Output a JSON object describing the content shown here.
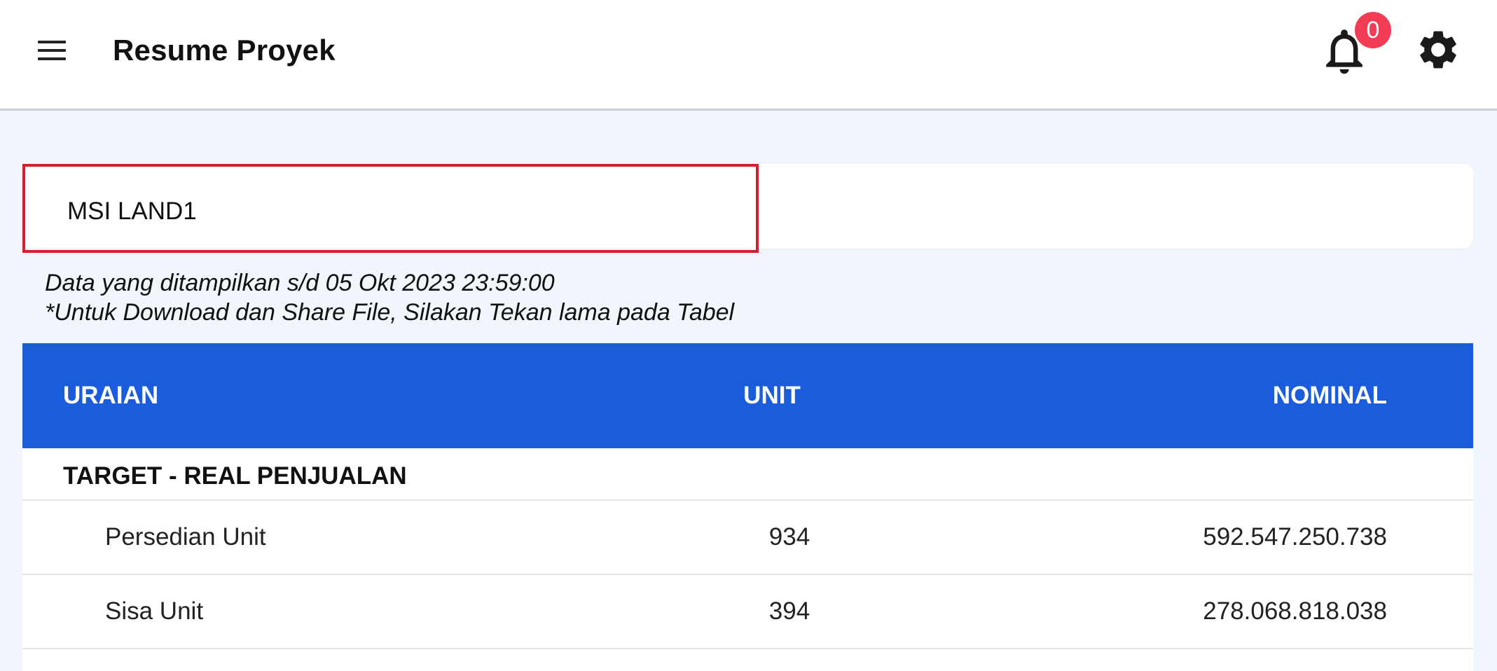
{
  "header": {
    "title": "Resume Proyek",
    "notification_count": "0"
  },
  "project": {
    "name": "MSI LAND1"
  },
  "info": {
    "line1": "Data yang ditampilkan s/d 05 Okt 2023 23:59:00",
    "line2": "*Untuk Download dan Share File, Silakan Tekan lama pada Tabel"
  },
  "table": {
    "columns": [
      "URAIAN",
      "UNIT",
      "NOMINAL"
    ],
    "section": "TARGET - REAL PENJUALAN",
    "rows": [
      {
        "label": "Persedian Unit",
        "unit": "934",
        "nominal": "592.547.250.738"
      },
      {
        "label": "Sisa Unit",
        "unit": "394",
        "nominal": "278.068.818.038"
      }
    ]
  },
  "colors": {
    "header_blue": "#1b5cdd",
    "badge_red": "#f23d55",
    "highlight_red": "#d3202a",
    "page_bg": "#f0f6fc"
  }
}
